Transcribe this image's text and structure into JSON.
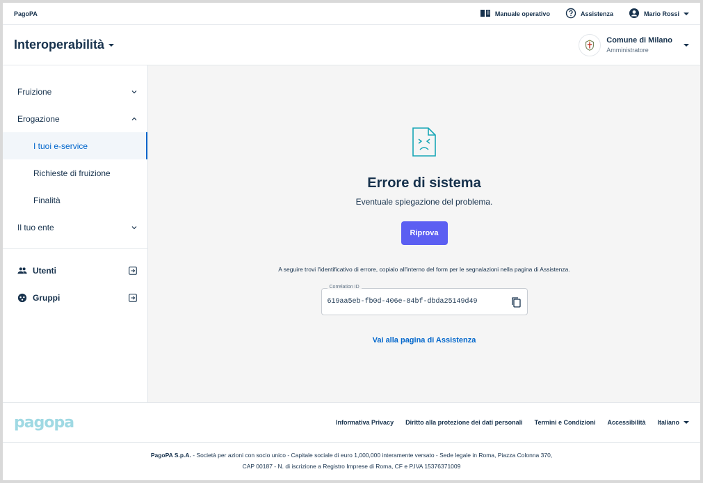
{
  "header": {
    "brand": "PagoPA",
    "manual_label": "Manuale operativo",
    "assist_label": "Assistenza",
    "user_name": "Mario Rossi"
  },
  "product": {
    "title": "Interoperabilità",
    "party_name": "Comune di Milano",
    "party_role": "Amministratore"
  },
  "sidebar": {
    "items": [
      {
        "label": "Fruizione"
      },
      {
        "label": "Erogazione"
      },
      {
        "label": "I tuoi e-service"
      },
      {
        "label": "Richieste di fruizione"
      },
      {
        "label": "Finalità"
      },
      {
        "label": "Il tuo ente"
      },
      {
        "label": "Utenti"
      },
      {
        "label": "Gruppi"
      }
    ]
  },
  "error": {
    "title": "Errore di sistema",
    "description": "Eventuale spiegazione del problema.",
    "retry_label": "Riprova",
    "hint": "A seguire trovi l'identificativo di errore, copialo all'interno del form per le segnalazioni nella pagina di Assistenza.",
    "correlation_label": "Correlation ID",
    "correlation_value": "619aa5eb-fb0d-406e-84bf-dbda25149d49",
    "assist_link": "Vai alla pagina di Assistenza"
  },
  "footer": {
    "logo_text": "pagopa",
    "links": [
      "Informativa Privacy",
      "Diritto alla protezione dei dati personali",
      "Termini e Condizioni",
      "Accessibilità"
    ],
    "language": "Italiano",
    "legal_company": "PagoPA S.p.A.",
    "legal_line1": " - Società per azioni con socio unico - Capitale sociale di euro 1,000,000 interamente versato - Sede legale in Roma, Piazza Colonna 370,",
    "legal_line2": "CAP 00187 - N. di iscrizione a Registro Imprese di Roma, CF e P.IVA 15376371009"
  },
  "colors": {
    "primary": "#0066cc",
    "button": "#5c5ff2",
    "text": "#17324d",
    "background": "#f5f5f5",
    "illustration": "#17a6b6"
  }
}
